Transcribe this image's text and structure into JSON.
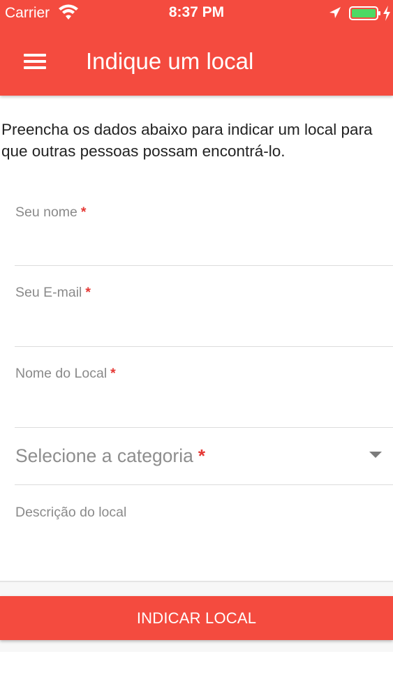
{
  "status_bar": {
    "carrier": "Carrier",
    "time": "8:37 PM",
    "icons": [
      "wifi-icon",
      "location-arrow-icon",
      "battery-icon",
      "charging-icon"
    ]
  },
  "header": {
    "title": "Indique um local",
    "menu_icon": "menu-icon",
    "background_color": "#f44b3f"
  },
  "intro": {
    "text": "Preencha os dados abaixo para indicar um local para que outras pessoas possam encontrá-lo."
  },
  "form": {
    "name": {
      "label": "Seu nome",
      "required_mark": "*",
      "value": ""
    },
    "email": {
      "label": "Seu E-mail",
      "required_mark": "*",
      "value": ""
    },
    "place_name": {
      "label": "Nome do Local",
      "required_mark": "*",
      "value": ""
    },
    "category": {
      "placeholder": "Selecione a categoria",
      "required_mark": "*",
      "icon": "chevron-down-icon"
    },
    "description": {
      "label": "Descrição do local",
      "value": ""
    }
  },
  "submit": {
    "label": "INDICAR LOCAL"
  },
  "colors": {
    "accent": "#f44b3f",
    "required": "#e53935",
    "label": "#8a8a8a"
  }
}
